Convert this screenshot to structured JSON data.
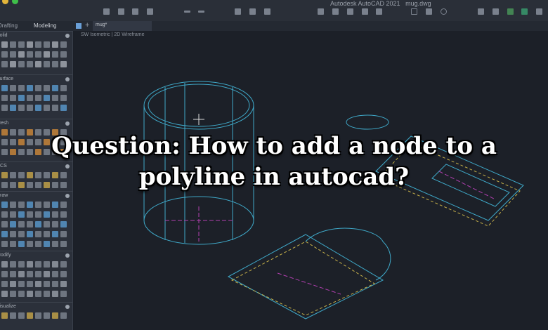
{
  "window": {
    "app_title": "Autodesk AutoCAD 2021",
    "file_title": "mug.dwg"
  },
  "ribbon_tabs": [
    "Drafting",
    "Modeling"
  ],
  "file_tab": "mug*",
  "viewport_label": "SW Isometric | 2D Wireframe",
  "panels": [
    "Solid",
    "Surface",
    "Mesh",
    "UCS",
    "Draw",
    "Modify",
    "Visualize"
  ],
  "headline": "Question: How to add a node to a polyline in autocad?",
  "colors": {
    "wire": "#3fa9c9",
    "dashed": "#c8b24a",
    "axis": "#b23fb0",
    "bg": "#1c2028"
  }
}
